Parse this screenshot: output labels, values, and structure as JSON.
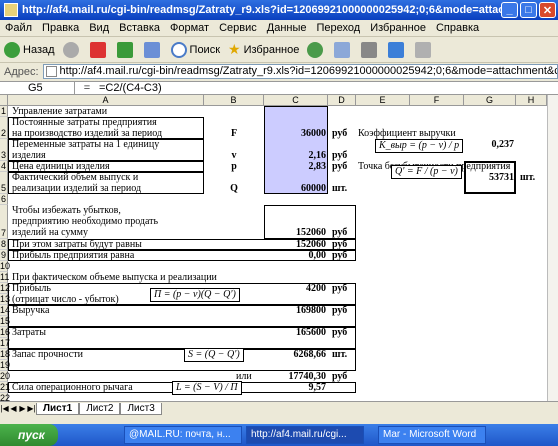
{
  "window": {
    "title": "http://af4.mail.ru/cgi-bin/readmsg/Zatraty_r9.xls?id=12069921000000025942;0;6&mode=attachment&c - Micros"
  },
  "menu": [
    "Файл",
    "Правка",
    "Вид",
    "Вставка",
    "Формат",
    "Сервис",
    "Данные",
    "Переход",
    "Избранное",
    "Справка"
  ],
  "toolbar": {
    "back": "Назад",
    "search": "Поиск",
    "favorites": "Избранное"
  },
  "address": {
    "label": "Адрес:",
    "url": "http://af4.mail.ru/cgi-bin/readmsg/Zatraty_r9.xls?id=12069921000000025942;0;6&mode=attachment&channel="
  },
  "formula_bar": {
    "cell": "G5",
    "formula": "=C2/(C4-C3)"
  },
  "columns": [
    "A",
    "B",
    "C",
    "D",
    "E",
    "F",
    "G",
    "H"
  ],
  "rows": [
    "1",
    "2",
    "3",
    "4",
    "5",
    "6",
    "7",
    "8",
    "9",
    "10",
    "11",
    "12",
    "13",
    "14",
    "15",
    "16",
    "17",
    "18",
    "19",
    "20",
    "21",
    "22"
  ],
  "sheet": {
    "r1": "Управление затратами",
    "r2a": "Постоянные затраты предприятия",
    "r2b": "на производство изделий за период",
    "r2_sym": "F",
    "r2_val": "36000",
    "r2_unit": "руб",
    "r2_e": "Коэффициент выручки",
    "r3a": "Переменные затраты на 1 единицу",
    "r3b": "изделия",
    "r3_sym": "v",
    "r3_val": "2,16",
    "r3_unit": "руб",
    "r4a": "Цена единицы изделия",
    "r4_sym": "p",
    "r4_val": "2,83",
    "r4_unit": "руб",
    "g4_val": "0,237",
    "r4_e": "Точка безубыточности предприятия",
    "r5a": "Фактический объем выпуск и",
    "r5b": "реализации изделий за период",
    "r5_sym": "Q",
    "r5_val": "60000",
    "r5_unit": "шт.",
    "g5_val": "53731",
    "h5_unit": "шт.",
    "r7a": "Чтобы избежать убытков,",
    "r7b": "предприятию  необходимо продать",
    "r7c": "изделий на сумму",
    "r7_val": "152060",
    "r7_unit": "руб",
    "r8a": "При этом затраты будут равны",
    "r8_val": "152060",
    "r8_unit": "руб",
    "r9a": "Прибыль предприятия равна",
    "r9_val": "0,00",
    "r9_unit": "руб",
    "r11a": "При фактическом объеме выпуска и реализации",
    "r12a": "Прибыль",
    "r13a": "(отрицат число - убыток)",
    "r12_val": "4200",
    "r12_unit": "руб",
    "r14a": "Выручка",
    "r14_val": "169800",
    "r14_unit": "руб",
    "r16a": "Затраты",
    "r16_val": "165600",
    "r16_unit": "руб",
    "r18a": "Запас прочности",
    "r18_val": "6268,66",
    "r18_unit": "шт.",
    "r20_or": "или",
    "r20_val": "17740,30",
    "r20_unit": "руб",
    "r21a": "Сила операционного рычага",
    "r21_val": "9,57"
  },
  "formulas": {
    "k": "K_выр = (p − v) / p",
    "q": "Q' = F / (p − v)",
    "pi": "П = (p − v)(Q − Q')",
    "s": "S = (Q − Q')",
    "l": "L = (S − V) / П"
  },
  "sheet_tabs": [
    "Лист1",
    "Лист2",
    "Лист3"
  ],
  "taskbar": {
    "start": "пуск",
    "tasks": [
      "@MAIL.RU: почта, н...",
      "http://af4.mail.ru/cgi...",
      "Mar - Microsoft Word"
    ]
  },
  "colors": {
    "highlight": "#ccccff",
    "titlebar": "#0a3fbf",
    "taskbar": "#245edb"
  }
}
